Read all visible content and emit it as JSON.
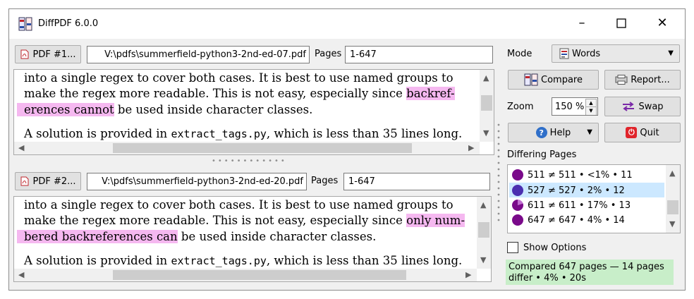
{
  "window": {
    "title": "DiffPDF 6.0.0"
  },
  "top": {
    "pdf_button": "PDF #1...",
    "file": "V:\\pdfs\\summerfield-python3-2nd-ed-07.pdf",
    "pages_label": "Pages",
    "pages": "1-647",
    "lines": [
      [
        "into a single regex to cover both cases.  It is best to use named groups to"
      ],
      [
        "make the regex more readable.  This is not easy, especially since ",
        "backref-"
      ],
      [
        "erences cannot",
        " be used inside character classes."
      ]
    ],
    "last_line_a": "A solution is provided in ",
    "last_line_code": "extract_tags.py",
    "last_line_b": ", which is less than 35 lines long."
  },
  "bottom": {
    "pdf_button": "PDF #2...",
    "file": "V:\\pdfs\\summerfield-python3-2nd-ed-20.pdf",
    "pages_label": "Pages",
    "pages": "1-647",
    "lines": [
      [
        "into a single regex to cover both cases.  It is best to use named groups to"
      ],
      [
        "make the regex more readable.  This is not easy, especially since ",
        "only num-"
      ],
      [
        "bered backreferences can",
        " be used inside character classes."
      ]
    ],
    "last_line_a": "A solution is provided in ",
    "last_line_code": "extract_tags.py",
    "last_line_b": ", which is less than 35 lines long."
  },
  "controls": {
    "mode_label": "Mode",
    "mode_value": "Words",
    "compare": "Compare",
    "report": "Report...",
    "zoom_label": "Zoom",
    "zoom_value": "150 %",
    "swap": "Swap",
    "help": "Help",
    "quit": "Quit",
    "differing_label": "Differing Pages",
    "differing": [
      {
        "text": "511 ≠ 511 • <1% • 11",
        "color": "#7a0a8a"
      },
      {
        "text": "527 ≠ 527 • 2% • 12",
        "color": "#4b2fb0"
      },
      {
        "text": "611 ≠ 611 • 17% • 13",
        "color": "#7a0a8a"
      },
      {
        "text": "647 ≠ 647 • 4% • 14",
        "color": "#7a0a8a"
      }
    ],
    "show_options": "Show Options",
    "status_line1": "Compared 647 pages — 14 pages",
    "status_line2": "differ • 4% • 20s"
  },
  "colors": {
    "highlight": "#f5b8f0",
    "selected_row": "#cce8ff",
    "status_bg": "#c8eec9",
    "quit_red": "#e0242b",
    "swap_purple": "#7b2aa8",
    "help_blue": "#2f6fc9"
  }
}
